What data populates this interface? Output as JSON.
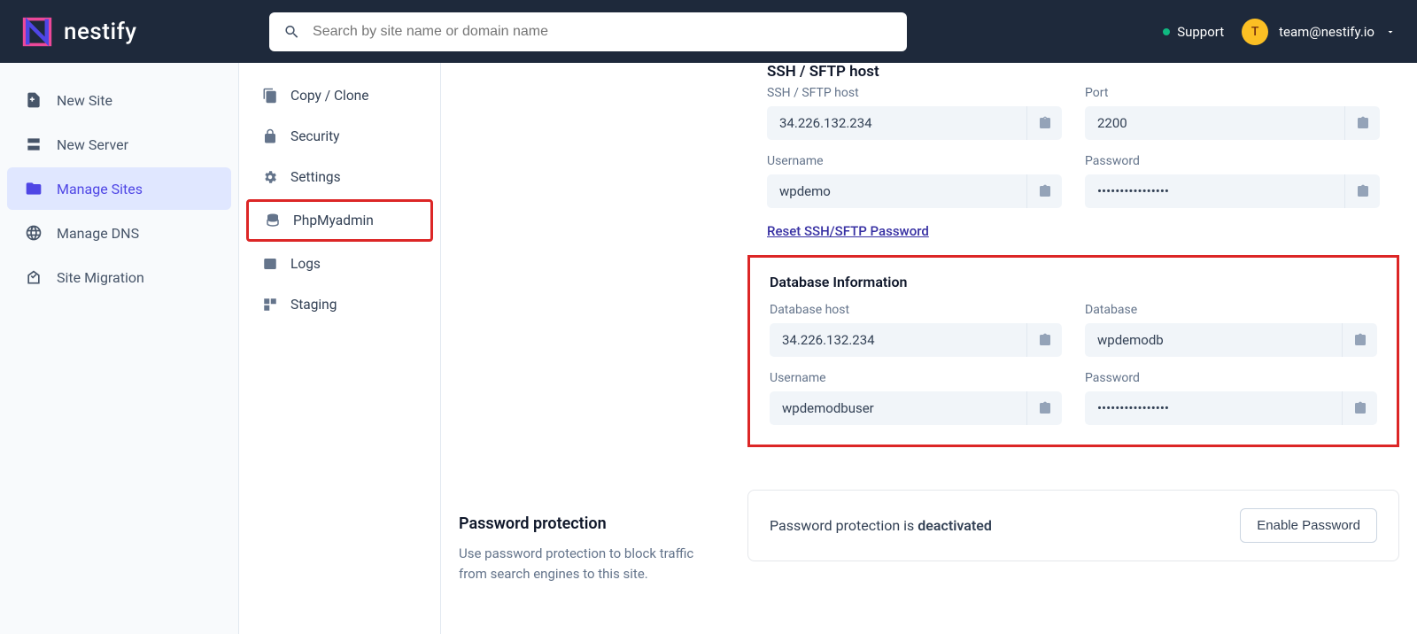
{
  "brand": {
    "name": "nestify"
  },
  "search": {
    "placeholder": "Search by site name or domain name"
  },
  "header": {
    "support": "Support",
    "avatar_initial": "T",
    "email": "team@nestify.io"
  },
  "sidebar": {
    "items": [
      {
        "label": "New Site",
        "icon": "plus-file"
      },
      {
        "label": "New Server",
        "icon": "server"
      },
      {
        "label": "Manage Sites",
        "icon": "folder",
        "active": true
      },
      {
        "label": "Manage DNS",
        "icon": "globe"
      },
      {
        "label": "Site Migration",
        "icon": "migrate"
      }
    ]
  },
  "submenu": {
    "items": [
      {
        "label": "Copy / Clone",
        "icon": "copy"
      },
      {
        "label": "Security",
        "icon": "lock"
      },
      {
        "label": "Settings",
        "icon": "gear"
      },
      {
        "label": "PhpMyadmin",
        "icon": "database",
        "highlighted": true
      },
      {
        "label": "Logs",
        "icon": "terminal"
      },
      {
        "label": "Staging",
        "icon": "stage"
      }
    ]
  },
  "ssh": {
    "title": "SSH / SFTP host",
    "host_label": "SSH / SFTP host",
    "host": "34.226.132.234",
    "port_label": "Port",
    "port": "2200",
    "username_label": "Username",
    "username": "wpdemo",
    "password_label": "Password",
    "password_mask": "••••••••••••••••",
    "reset_link": "Reset SSH/SFTP Password"
  },
  "db": {
    "title": "Database Information",
    "host_label": "Database host",
    "host": "34.226.132.234",
    "db_label": "Database",
    "db": "wpdemodb",
    "username_label": "Username",
    "username": "wpdemodbuser",
    "password_label": "Password",
    "password_mask": "••••••••••••••••"
  },
  "pw_protect": {
    "heading": "Password protection",
    "desc": "Use password protection to block traffic from search engines to this site.",
    "status_prefix": "Password protection is ",
    "status_value": "deactivated",
    "button": "Enable Password"
  }
}
